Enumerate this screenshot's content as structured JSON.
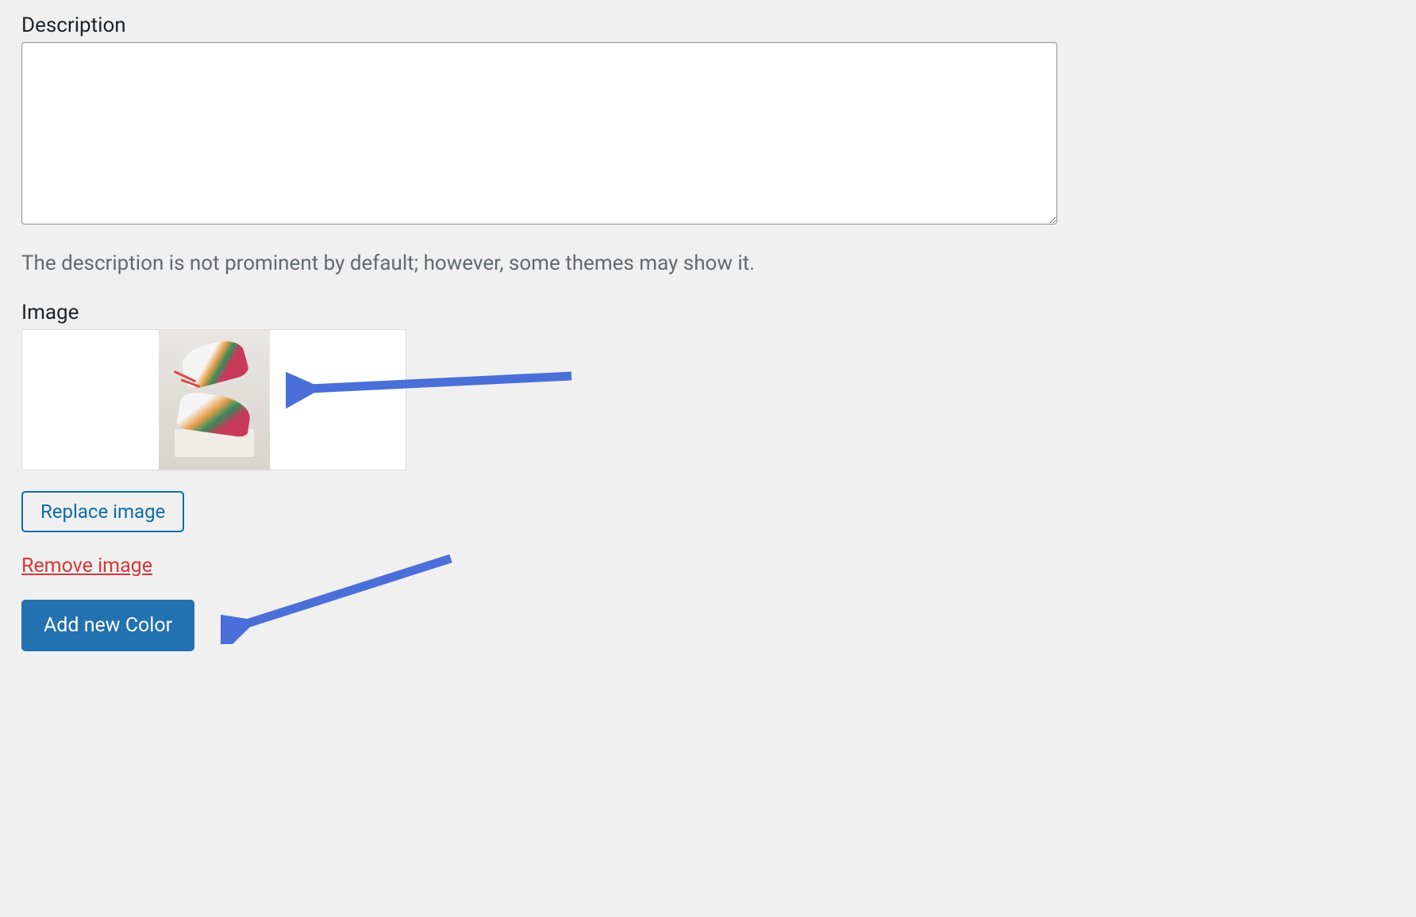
{
  "description": {
    "label": "Description",
    "value": "",
    "help_text": "The description is not prominent by default; however, some themes may show it."
  },
  "image": {
    "label": "Image",
    "replace_label": "Replace image",
    "remove_label": "Remove image"
  },
  "submit": {
    "label": "Add new Color"
  },
  "colors": {
    "link": "#0a6da8",
    "danger": "#d63638",
    "primary": "#2271b1",
    "arrow": "#4a6fd8"
  }
}
